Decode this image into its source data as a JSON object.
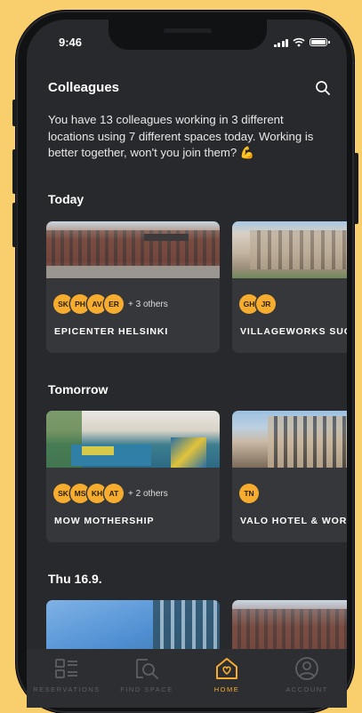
{
  "status": {
    "time": "9:46"
  },
  "header": {
    "title": "Colleagues"
  },
  "intro": {
    "text": "You have 13 colleagues working in 3 different locations using 7 different spaces today. Working is better together, won't you join them? 💪"
  },
  "sections": [
    {
      "title": "Today",
      "cards": [
        {
          "avatars": [
            "SK",
            "PH",
            "AV",
            "ER"
          ],
          "others": "+ 3 others",
          "name": "EPICENTER HELSINKI"
        },
        {
          "avatars": [
            "GH",
            "JR"
          ],
          "others": "",
          "name": "VILLAGEWORKS SUOMI"
        }
      ]
    },
    {
      "title": "Tomorrow",
      "cards": [
        {
          "avatars": [
            "SK",
            "MS",
            "KH",
            "AT"
          ],
          "others": "+ 2 others",
          "name": "MOW MOTHERSHIP"
        },
        {
          "avatars": [
            "TN"
          ],
          "others": "",
          "name": "VALO HOTEL & WORK"
        }
      ]
    },
    {
      "title": "Thu 16.9."
    }
  ],
  "tabbar": {
    "items": [
      {
        "label": "RESERVATIONS",
        "icon": "list-icon"
      },
      {
        "label": "FIND SPACE",
        "icon": "find-space-icon"
      },
      {
        "label": "HOME",
        "icon": "home-heart-icon"
      },
      {
        "label": "ACCOUNT",
        "icon": "account-icon"
      }
    ]
  },
  "colors": {
    "accent": "#f6ad2f",
    "background": "#27292c",
    "card": "#35373b",
    "outer": "#f9cf6e"
  }
}
